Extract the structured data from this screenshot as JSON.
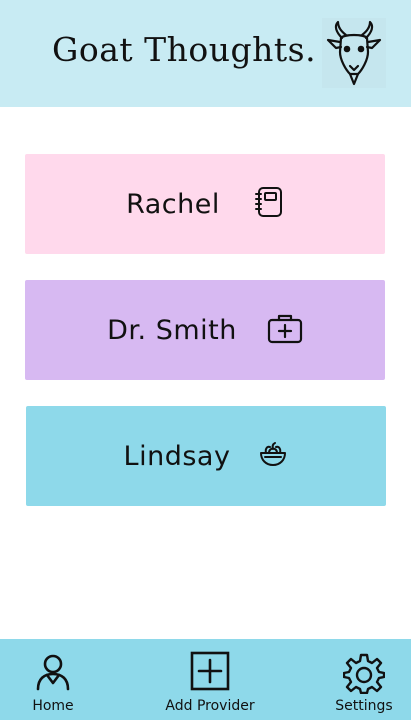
{
  "header": {
    "title": "Goat Thoughts.",
    "logo_icon": "goat-head-icon"
  },
  "providers": [
    {
      "name": "Rachel",
      "icon": "notebook-icon",
      "color": "#ffd9ec"
    },
    {
      "name": "Dr. Smith",
      "icon": "medical-kit-icon",
      "color": "#d7b9f2"
    },
    {
      "name": "Lindsay",
      "icon": "salad-bowl-icon",
      "color": "#8ed9ea"
    }
  ],
  "nav": {
    "home_label": "Home",
    "add_provider_label": "Add Provider",
    "settings_label": "Settings"
  },
  "colors": {
    "header_bg": "#c8ebf3",
    "nav_bg": "#8ed9ea"
  }
}
